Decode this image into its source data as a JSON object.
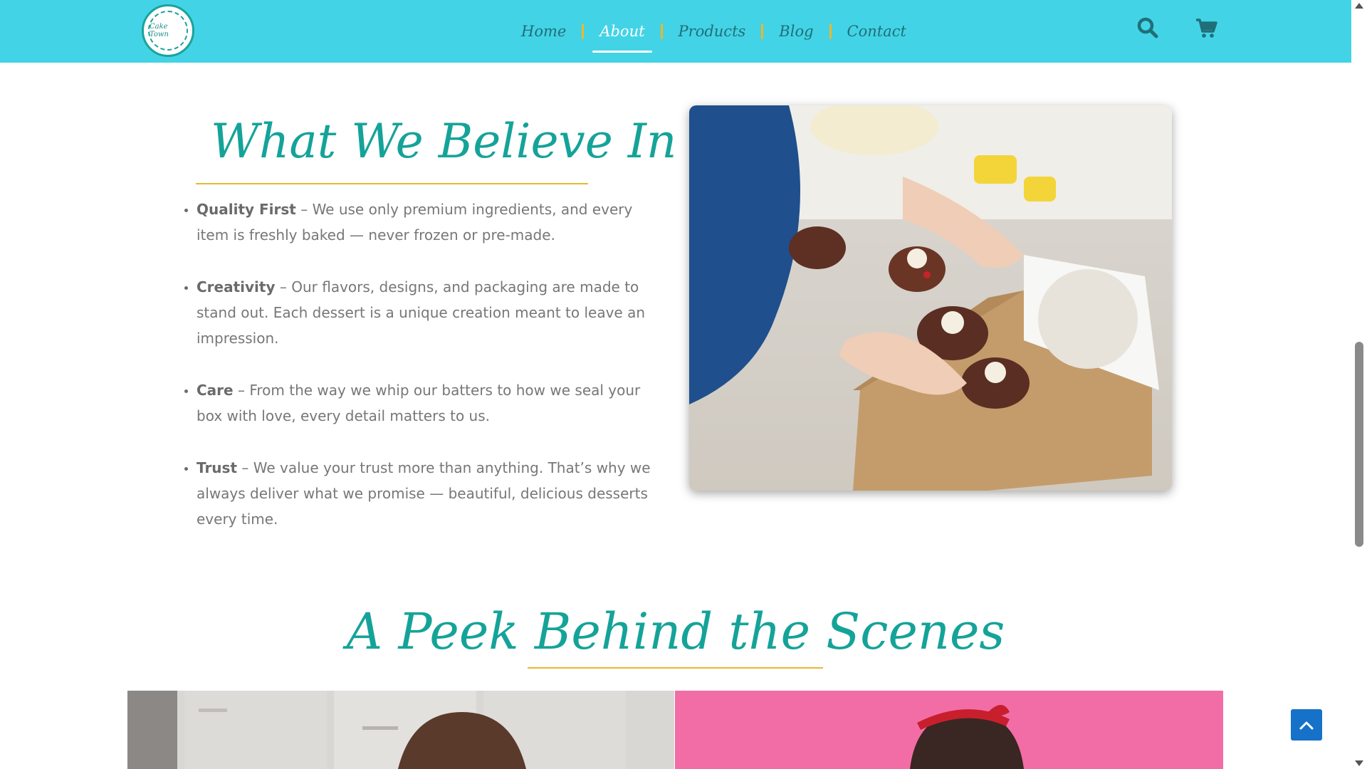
{
  "header": {
    "logo_text": "Cake Town",
    "nav": [
      {
        "label": "Home",
        "active": false
      },
      {
        "label": "About",
        "active": true
      },
      {
        "label": "Products",
        "active": false
      },
      {
        "label": "Blog",
        "active": false
      },
      {
        "label": "Contact",
        "active": false
      }
    ],
    "icons": [
      "search-icon",
      "cart-icon"
    ],
    "background_color": "#43d3e6",
    "separator_color": "#e8b82e"
  },
  "believe": {
    "title": "What We Believe In",
    "items": [
      {
        "heading": "Quality First",
        "text": " – We use only premium ingredients, and every item is freshly baked — never frozen or pre-made."
      },
      {
        "heading": "Creativity",
        "text": " – Our flavors, designs, and packaging are made to stand out. Each dessert is a unique creation meant to leave an impression."
      },
      {
        "heading": "Care",
        "text": " – From the way we whip our batters to how we seal your box with love, every detail matters to us."
      },
      {
        "heading": "Trust",
        "text": " – We value your trust more than anything. That’s why we always deliver what we promise — beautiful, delicious desserts every time."
      }
    ]
  },
  "peek": {
    "title": "A Peek Behind the Scenes"
  },
  "colors": {
    "accent": "#15a399",
    "underline": "#e8b82e",
    "to_top_button": "#1672c9"
  }
}
